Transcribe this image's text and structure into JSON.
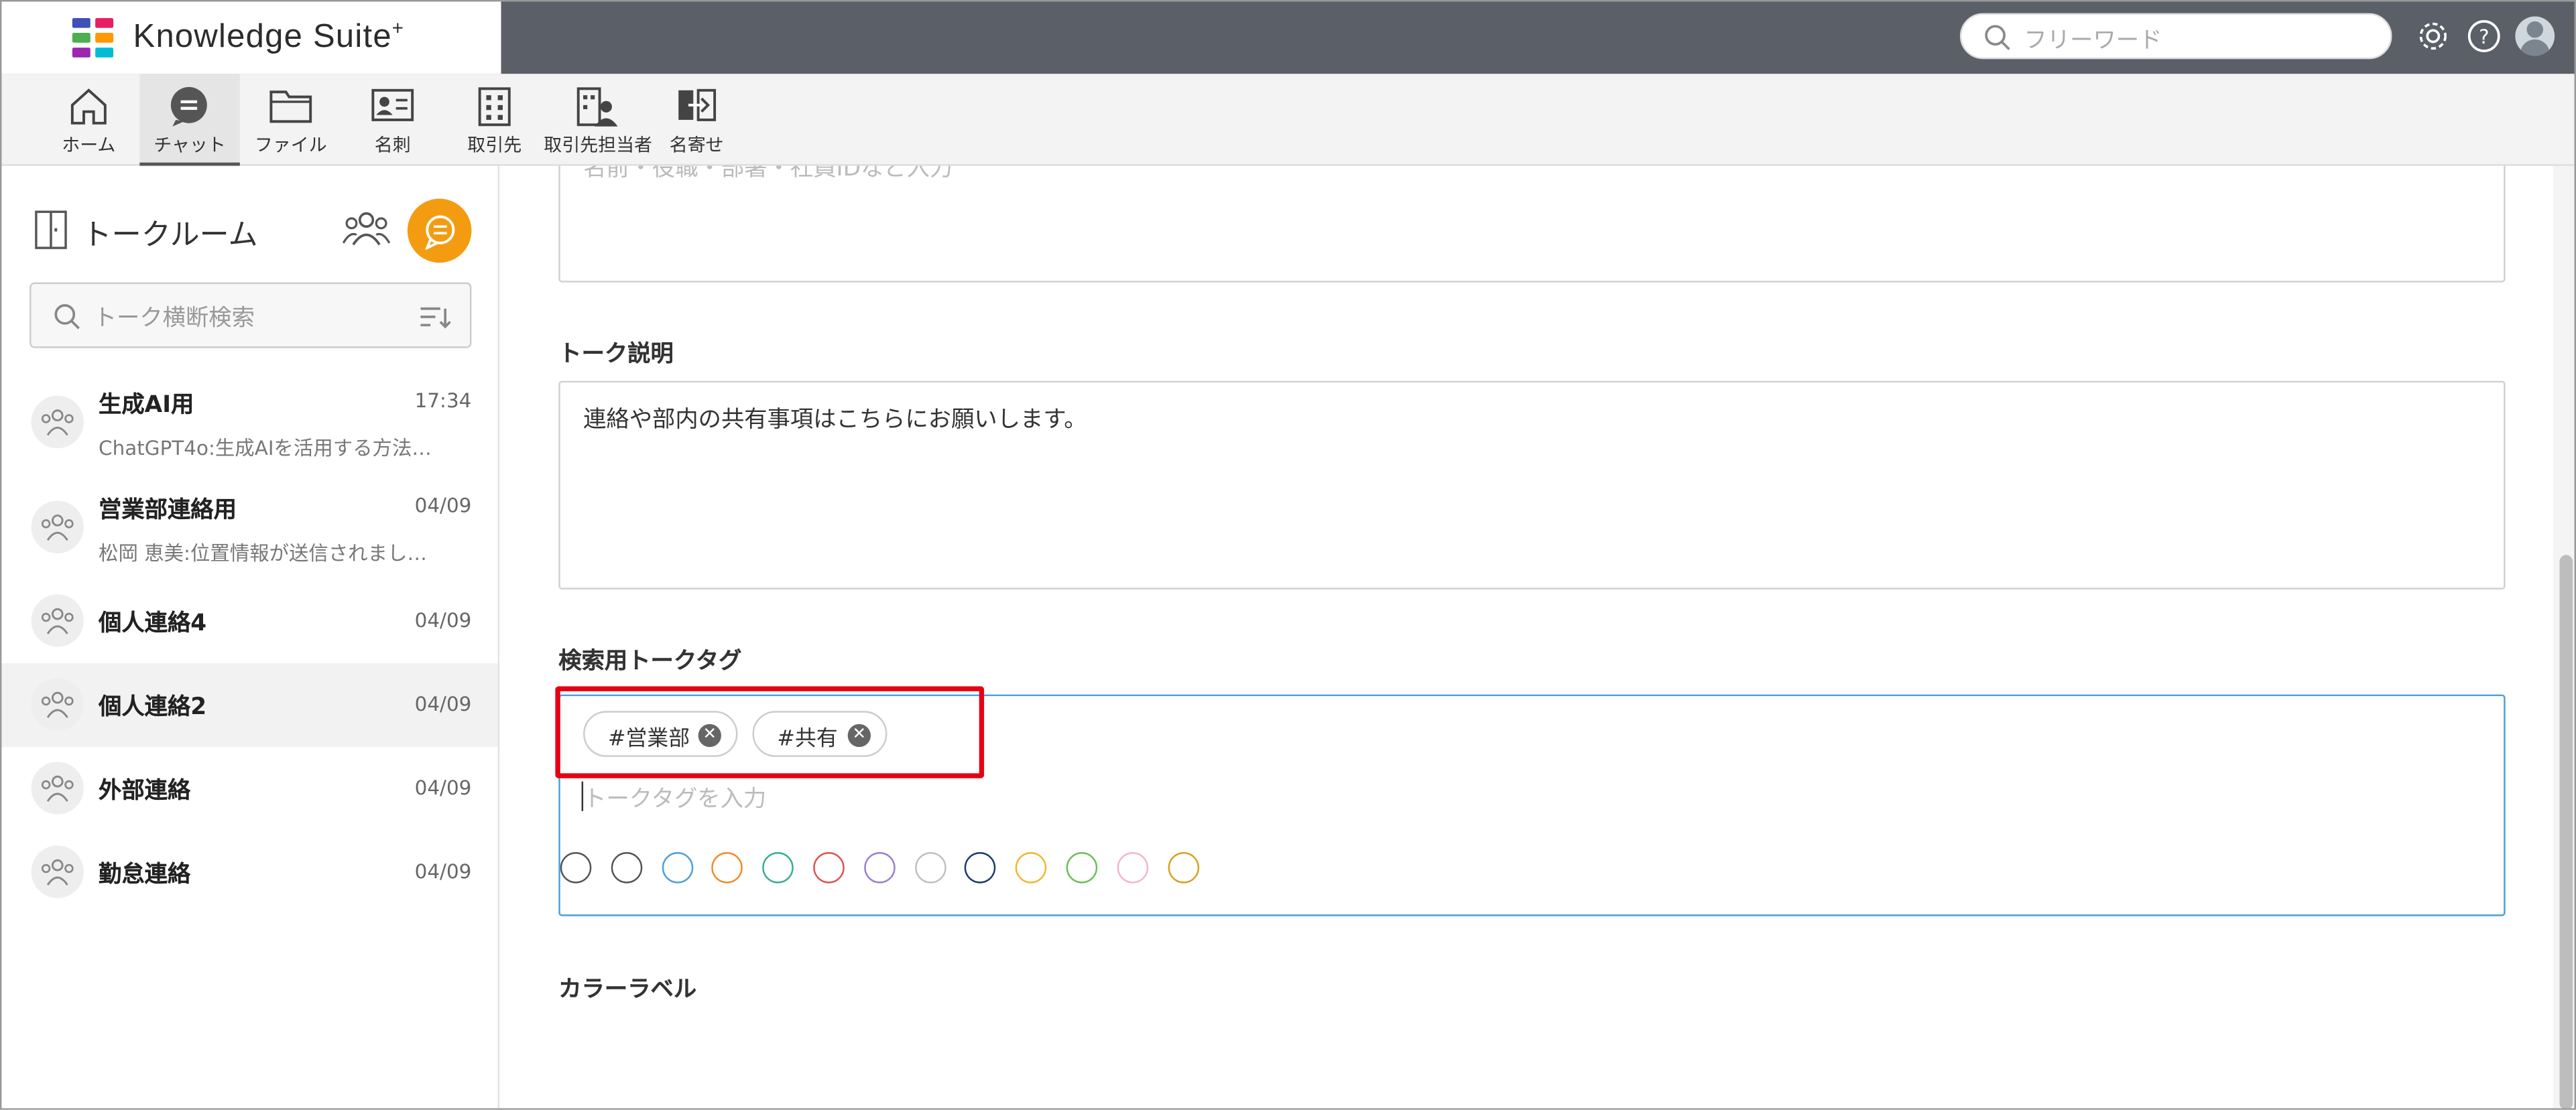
{
  "app": {
    "title": "Knowledge Suite",
    "title_sup": "+"
  },
  "header": {
    "search_placeholder": "フリーワード"
  },
  "toolbar": {
    "items": [
      {
        "label": "ホーム"
      },
      {
        "label": "チャット"
      },
      {
        "label": "ファイル"
      },
      {
        "label": "名刺"
      },
      {
        "label": "取引先"
      },
      {
        "label": "取引先担当者"
      },
      {
        "label": "名寄せ"
      }
    ]
  },
  "sidebar": {
    "title": "トークルーム",
    "search_placeholder": "トーク横断検索",
    "rooms": [
      {
        "name": "生成AI用",
        "time": "17:34",
        "preview": "ChatGPT4o:生成AIを活用する方法…"
      },
      {
        "name": "営業部連絡用",
        "time": "04/09",
        "preview": "松岡 恵美:位置情報が送信されまし…"
      },
      {
        "name": "個人連絡4",
        "time": "04/09"
      },
      {
        "name": "個人連絡2",
        "time": "04/09"
      },
      {
        "name": "外部連絡",
        "time": "04/09"
      },
      {
        "name": "勤怠連絡",
        "time": "04/09"
      }
    ]
  },
  "form": {
    "member_placeholder": "名前・役職・部署・社員IDなど入力",
    "description_label": "トーク説明",
    "description_value": "連絡や部内の共有事項はこちらにお願いします。",
    "tags_label": "検索用トークタグ",
    "tags": [
      "#営業部",
      "#共有"
    ],
    "tag_placeholder": "トークタグを入力",
    "color_label": "カラーラベル",
    "colors": [
      "#555555",
      "#555555",
      "#4a9fe0",
      "#f08c2a",
      "#34b08f",
      "#e05252",
      "#9b7fd1",
      "#c0c0c0",
      "#1f3a6e",
      "#f2b632",
      "#6bbf5a",
      "#f2b8c6",
      "#d9a020"
    ]
  }
}
